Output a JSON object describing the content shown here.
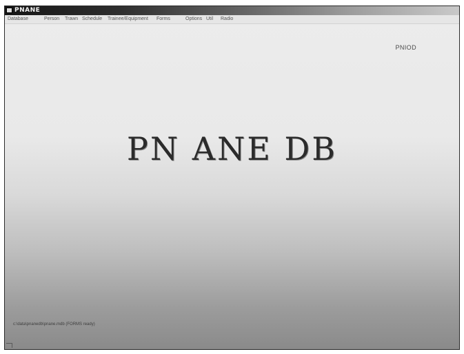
{
  "window": {
    "title": "PNANE"
  },
  "menu": {
    "items": [
      "Database",
      "Person",
      "Trawn",
      "Schedule",
      "Trainee/Equipment",
      "Forms",
      "Options",
      "Util",
      "Radio"
    ]
  },
  "header": {
    "user_label": "PNIOD"
  },
  "main": {
    "logo_text": "PN ANE DB"
  },
  "status": {
    "text": "c:\\data\\pnanedb\\pnane.mdb (FORMS ready)"
  }
}
